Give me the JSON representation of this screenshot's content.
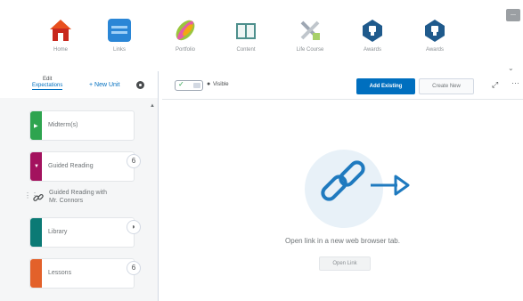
{
  "nav": {
    "items": [
      {
        "label": "Home",
        "icon": "home-icon"
      },
      {
        "label": "Links",
        "icon": "links-icon"
      },
      {
        "label": "Portfolio",
        "icon": "portfolio-icon"
      },
      {
        "label": "Content",
        "icon": "book-icon"
      },
      {
        "label": "Life Course",
        "icon": "tools-icon"
      },
      {
        "label": "Awards",
        "icon": "award-icon"
      },
      {
        "label": "Awards",
        "icon": "award-icon"
      }
    ],
    "corner_label": "---"
  },
  "left_panel": {
    "edit_top": "Edit",
    "edit_bottom": "Expectations",
    "new_unit": "+ New Unit",
    "units": [
      {
        "title": "Midterm(s)",
        "color": "#2ea44f"
      },
      {
        "title": "Guided Reading",
        "color": "#a3125e",
        "badge": "6"
      },
      {
        "title": "Library",
        "color": "#0b7a75",
        "badge": "◗"
      },
      {
        "title": "Lessons",
        "color": "#e3612a",
        "badge": "6"
      }
    ],
    "topic": {
      "line1": "Guided Reading with",
      "line2": "Mr. Connors"
    }
  },
  "toolbar": {
    "visibility_label": "Visible",
    "add_existing": "Add Existing",
    "create_new": "Create New"
  },
  "main": {
    "message": "Open link in a new web browser tab.",
    "open_button": "Open Link"
  },
  "colors": {
    "accent": "#006fbf",
    "link_icon": "#1f7abf"
  }
}
